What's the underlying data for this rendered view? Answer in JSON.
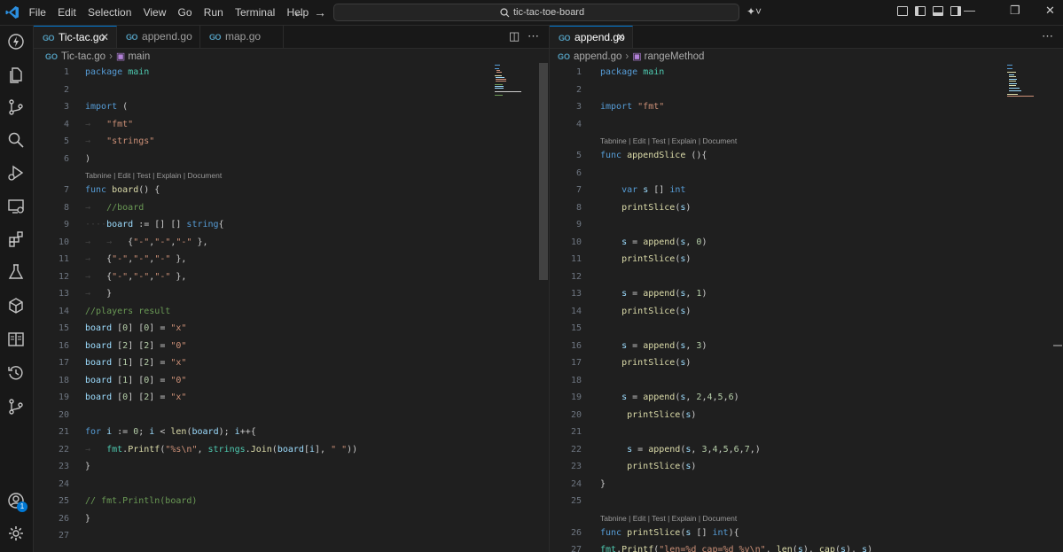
{
  "menu": [
    "File",
    "Edit",
    "Selection",
    "View",
    "Go",
    "Run",
    "Terminal",
    "Help"
  ],
  "search": {
    "text": "tic-tac-toe-board"
  },
  "icons": {
    "logo": "vscode-logo-icon",
    "back": "arrow-left-icon",
    "forward": "arrow-right-icon",
    "search": "search-icon",
    "copilot": "copilot-icon"
  },
  "activity": {
    "items": [
      "copilot",
      "explorer",
      "source-control",
      "search",
      "run-debug",
      "remote-explorer",
      "extensions",
      "testing",
      "containers",
      "book",
      "timeline",
      "git-graph"
    ],
    "account_badge": "1"
  },
  "left": {
    "tabs": [
      {
        "label": "Tic-tac.go",
        "active": true
      },
      {
        "label": "append.go",
        "active": false
      },
      {
        "label": "map.go",
        "active": false
      }
    ],
    "breadcrumb": {
      "file": "Tic-tac.go",
      "symbol": "main"
    },
    "lens_text": "Tabnine | Edit | Test | Explain | Document",
    "line_numbers": [
      "1",
      "2",
      "3",
      "4",
      "5",
      "6",
      "7",
      "8",
      "9",
      "10",
      "11",
      "12",
      "13",
      "14",
      "15",
      "16",
      "17",
      "18",
      "19",
      "20",
      "21",
      "22",
      "23",
      "24",
      "25",
      "26",
      "27"
    ],
    "comments": {
      "board": "//board",
      "players": "//players result",
      "println": "// fmt.Println(board)"
    },
    "strings": {
      "fmt": "\"fmt\"",
      "strings": "\"strings\"",
      "x": "\"x\"",
      "o": "\"0\"",
      "format": "\"%s\\n\"",
      "space": "\" \""
    }
  },
  "right": {
    "tabs": [
      {
        "label": "append.go",
        "active": true
      }
    ],
    "breadcrumb": {
      "file": "append.go",
      "symbol": "rangeMethod"
    },
    "lens_text": "Tabnine | Edit | Test | Explain | Document",
    "line_numbers": [
      "1",
      "2",
      "3",
      "4",
      "5",
      "6",
      "7",
      "8",
      "9",
      "10",
      "11",
      "12",
      "13",
      "14",
      "15",
      "16",
      "17",
      "18",
      "19",
      "20",
      "21",
      "22",
      "23",
      "24",
      "25",
      "26",
      "27"
    ],
    "strings": {
      "fmt": "\"fmt\"",
      "format": "\"len=%d cap=%d %v\\n\""
    }
  }
}
